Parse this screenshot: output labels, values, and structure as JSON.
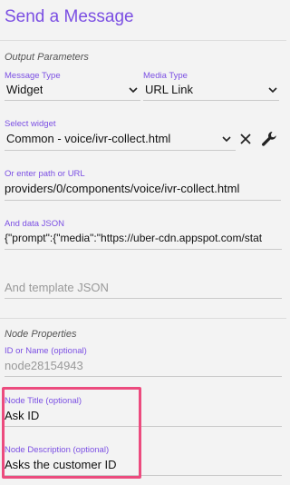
{
  "header": {
    "title": "Send a Message"
  },
  "output": {
    "section_title": "Output Parameters",
    "message_type": {
      "label": "Message Type",
      "value": "Widget"
    },
    "media_type": {
      "label": "Media Type",
      "value": "URL Link"
    },
    "widget": {
      "label": "Select widget",
      "value": "Common - voice/ivr-collect.html",
      "clear_icon": "close-icon",
      "config_icon": "wrench-icon"
    },
    "path": {
      "label": "Or enter path or URL",
      "value": "providers/0/components/voice/ivr-collect.html"
    },
    "data_json": {
      "label": "And data JSON",
      "value": "{\"prompt\":{\"media\":\"https://uber-cdn.appspot.com/stat"
    },
    "template_json": {
      "placeholder": "And template JSON"
    }
  },
  "node": {
    "section_title": "Node Properties",
    "id": {
      "label": "ID or Name (optional)",
      "value": "node28154943"
    },
    "title": {
      "label": "Node Title (optional)",
      "value": "Ask ID"
    },
    "description": {
      "label": "Node Description (optional)",
      "value": "Asks the customer ID"
    }
  },
  "colors": {
    "accent": "#7b4fe3",
    "highlight": "#ec4b7e"
  }
}
